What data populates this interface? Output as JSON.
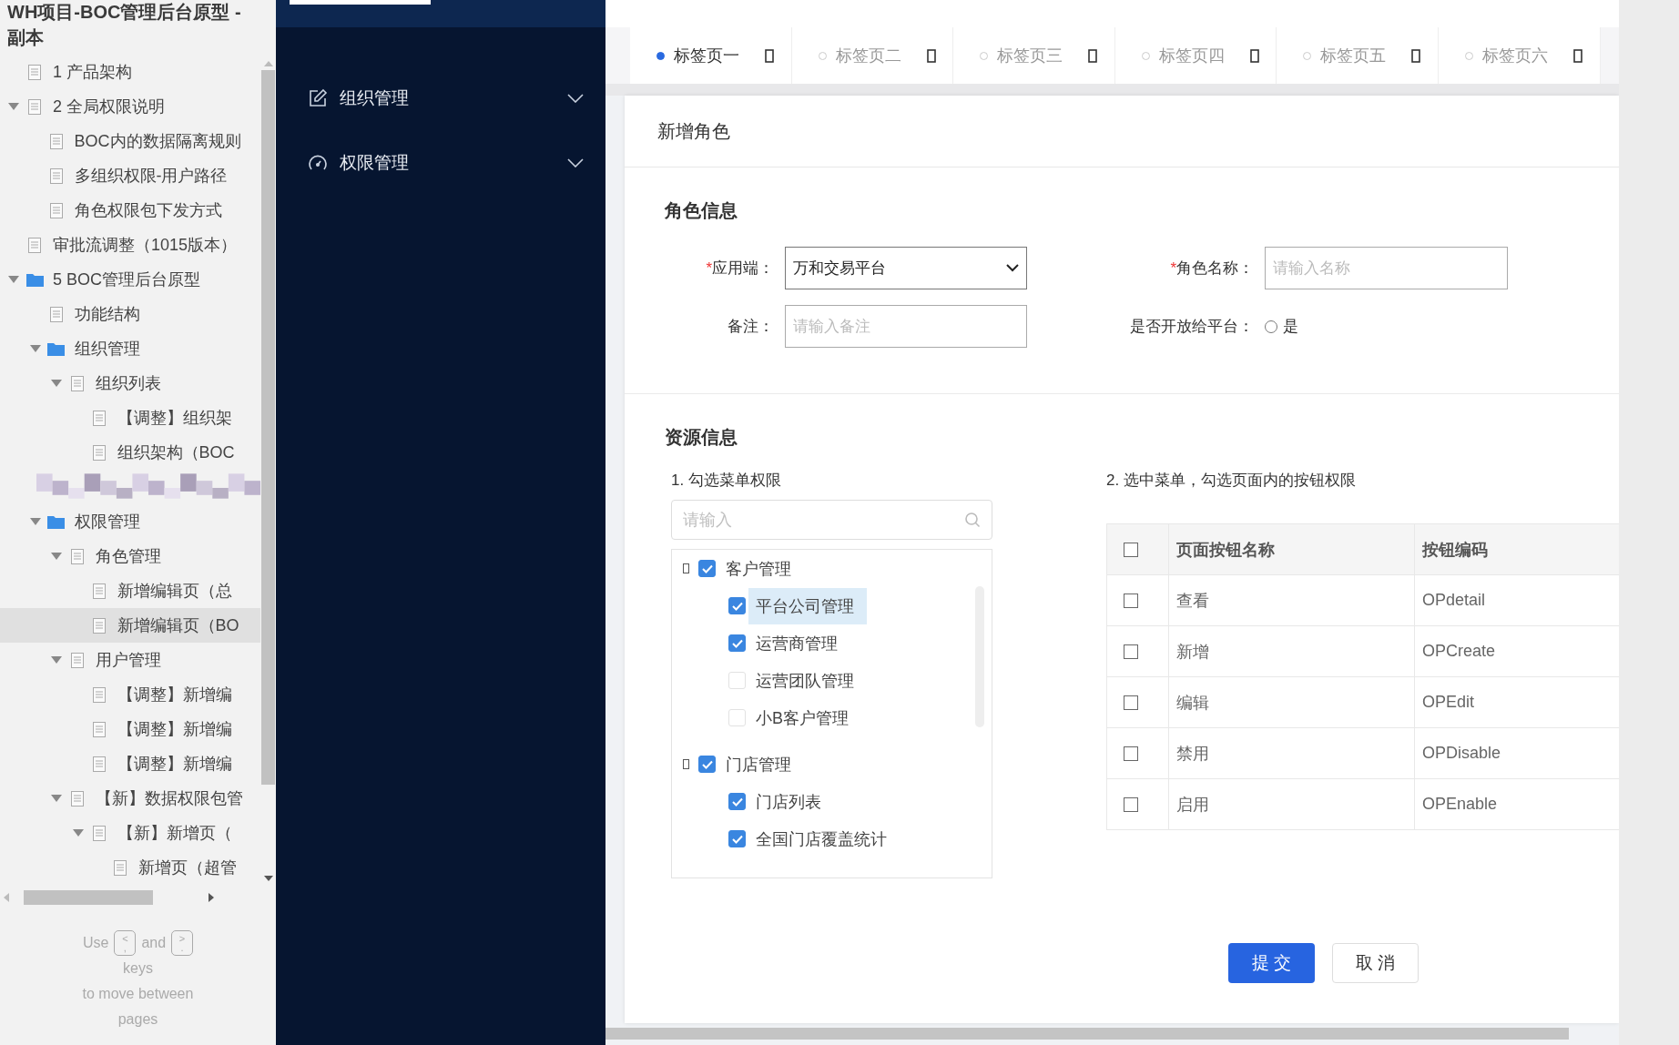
{
  "outline": {
    "title": "WH项目-BOC管理后台原型 - 副本",
    "items": [
      {
        "label": "1 产品架构",
        "kind": "page",
        "selected": false
      },
      {
        "label": "2 全局权限说明",
        "kind": "page",
        "expanded": true,
        "selected": false,
        "children": [
          {
            "label": "BOC内的数据隔离规则",
            "kind": "page",
            "selected": false
          },
          {
            "label": "多组织权限-用户路径",
            "kind": "page",
            "selected": false
          },
          {
            "label": "角色权限包下发方式",
            "kind": "page",
            "selected": false
          }
        ]
      },
      {
        "label": "审批流调整（1015版本）",
        "kind": "page",
        "selected": false
      },
      {
        "label": "5 BOC管理后台原型",
        "kind": "folder",
        "expanded": true,
        "selected": false,
        "children": [
          {
            "kind": "page",
            "label": "功能结构",
            "selected": false
          },
          {
            "kind": "folder",
            "label": "组织管理",
            "expanded": true,
            "selected": false,
            "children": [
              {
                "label": "组织列表",
                "kind": "page",
                "expanded": true,
                "selected": false,
                "children": [
                  {
                    "label": "【调整】组织架",
                    "kind": "page",
                    "selected": false
                  },
                  {
                    "label": "组织架构（BOC",
                    "kind": "page",
                    "selected": false
                  }
                ]
              }
            ]
          },
          {
            "kind": "blurred"
          },
          {
            "kind": "folder",
            "label": "权限管理",
            "expanded": true,
            "selected": false,
            "children": [
              {
                "label": "角色管理",
                "kind": "page",
                "expanded": true,
                "selected": false,
                "children": [
                  {
                    "label": "新增编辑页（总",
                    "kind": "page",
                    "selected": false
                  },
                  {
                    "label": "新增编辑页（BO",
                    "kind": "page",
                    "selected": true
                  }
                ]
              },
              {
                "label": "用户管理",
                "kind": "page",
                "expanded": true,
                "selected": false,
                "children": [
                  {
                    "label": "【调整】新增编",
                    "kind": "page",
                    "selected": false
                  },
                  {
                    "label": "【调整】新增编",
                    "kind": "page",
                    "selected": false
                  },
                  {
                    "label": "【调整】新增编",
                    "kind": "page",
                    "selected": false
                  }
                ]
              },
              {
                "label": "【新】数据权限包管",
                "kind": "page",
                "expanded": true,
                "selected": false,
                "children": [
                  {
                    "label": "【新】新增页（",
                    "kind": "page",
                    "expanded": true,
                    "selected": false,
                    "children": [
                      {
                        "label": "新增页（超管",
                        "kind": "page",
                        "selected": false
                      }
                    ]
                  }
                ]
              }
            ]
          }
        ]
      }
    ],
    "hint": {
      "before": "Use",
      "keys": [
        {
          "upper": "<",
          "lower": ","
        },
        {
          "upper": ">",
          "lower": "."
        }
      ],
      "between": "and",
      "lines": [
        "keys",
        "to move between",
        "pages"
      ]
    }
  },
  "nav": {
    "menus": [
      {
        "label": "组织管理",
        "expanded": false
      },
      {
        "label": "权限管理",
        "expanded": false
      }
    ]
  },
  "tabs": [
    {
      "label": "标签页一",
      "selected": true
    },
    {
      "label": "标签页二",
      "selected": false
    },
    {
      "label": "标签页三",
      "selected": false
    },
    {
      "label": "标签页四",
      "selected": false
    },
    {
      "label": "标签页五",
      "selected": false
    },
    {
      "label": "标签页六",
      "selected": false
    }
  ],
  "card": {
    "title": "新增角色",
    "role_info": {
      "title": "角色信息",
      "fields": [
        {
          "kind": "select",
          "required_mark": "*",
          "label": "应用端：",
          "value": "万和交易平台"
        },
        {
          "kind": "input",
          "required_mark": "*",
          "label": "角色名称：",
          "placeholder": "请输入名称"
        },
        {
          "kind": "input",
          "label": "备注：",
          "placeholder": "请输入备注"
        },
        {
          "kind": "radio",
          "label": "是否开放给平台：",
          "options": [
            {
              "label": "是",
              "selected": false
            }
          ]
        }
      ]
    },
    "resources": {
      "title": "资源信息",
      "menu_panel": {
        "heading": "1. 勾选菜单权限",
        "search": {
          "placeholder": "请输入"
        },
        "tree": [
          {
            "label": "客户管理",
            "checked": true,
            "selected": false,
            "children": [
              {
                "label": "平台公司管理",
                "checked": true,
                "selected": true
              },
              {
                "label": "运营商管理",
                "checked": true,
                "selected": false
              },
              {
                "label": "运营团队管理",
                "checked": false,
                "selected": false
              },
              {
                "label": "小B客户管理",
                "checked": false,
                "selected": false
              }
            ]
          },
          {
            "label": "门店管理",
            "checked": true,
            "selected": false,
            "children": [
              {
                "label": "门店列表",
                "checked": true,
                "selected": false
              },
              {
                "label": "全国门店覆盖统计",
                "checked": true,
                "selected": false
              }
            ]
          }
        ]
      },
      "button_panel": {
        "heading": "2. 选中菜单，勾选页面内的按钮权限",
        "table": {
          "header_checked": false,
          "columns": [
            "页面按钮名称",
            "按钮编码"
          ],
          "rows": [
            {
              "checked": false,
              "name": "查看",
              "code": "OPdetail"
            },
            {
              "checked": false,
              "name": "新增",
              "code": "OPCreate"
            },
            {
              "checked": false,
              "name": "编辑",
              "code": "OPEdit"
            },
            {
              "checked": false,
              "name": "禁用",
              "code": "OPDisable"
            },
            {
              "checked": false,
              "name": "启用",
              "code": "OPEnable"
            }
          ]
        }
      }
    },
    "actions": [
      {
        "label": "提 交",
        "kind": "primary"
      },
      {
        "label": "取 消",
        "kind": "default"
      }
    ]
  }
}
